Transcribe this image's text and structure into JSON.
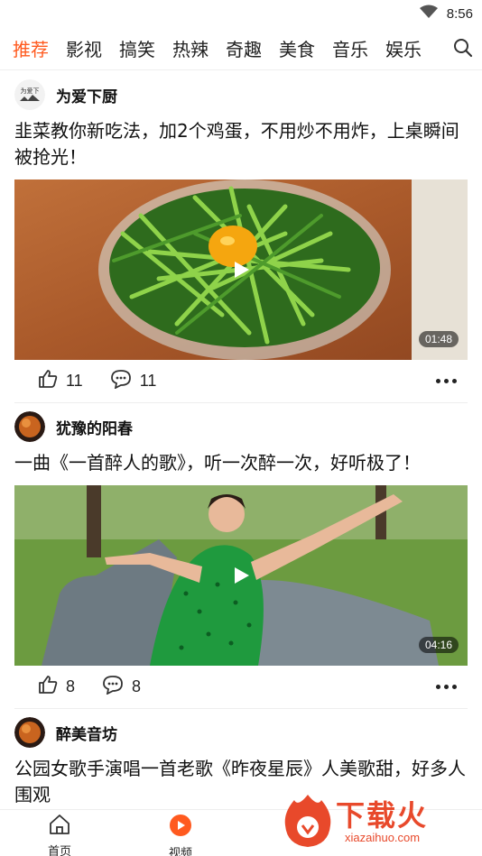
{
  "status_bar": {
    "time": "8:56"
  },
  "tabs": [
    {
      "label": "推荐",
      "active": true
    },
    {
      "label": "影视"
    },
    {
      "label": "搞笑"
    },
    {
      "label": "热辣"
    },
    {
      "label": "奇趣"
    },
    {
      "label": "美食"
    },
    {
      "label": "音乐"
    },
    {
      "label": "娱乐"
    }
  ],
  "feed": [
    {
      "author": "为爱下厨",
      "title": "韭菜教你新吃法，加2个鸡蛋，不用炒不用炸，上桌瞬间被抢光！",
      "duration": "01:48",
      "likes": "11",
      "comments": "11"
    },
    {
      "author": "犹豫的阳春",
      "title": "一曲《一首醉人的歌》，听一次醉一次，好听极了！",
      "duration": "04:16",
      "likes": "8",
      "comments": "8"
    },
    {
      "author": "醉美音坊",
      "title": "公园女歌手演唱一首老歌《昨夜星辰》人美歌甜，好多人围观"
    }
  ],
  "avatar_text": "为爱下",
  "bottom_nav": [
    {
      "label": "首页"
    },
    {
      "label": "视频"
    }
  ],
  "watermark": {
    "text": "下载火",
    "url": "xiazaihuo.com"
  },
  "colors": {
    "accent": "#ff5a1f",
    "watermark": "#e8492b"
  }
}
